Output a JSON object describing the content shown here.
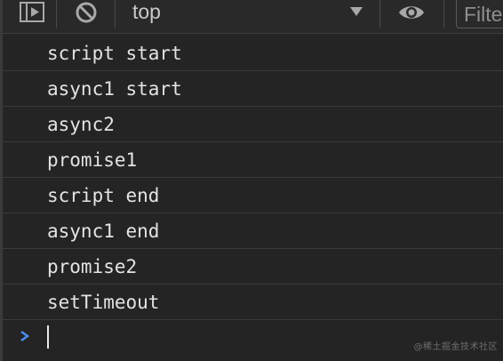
{
  "toolbar": {
    "icons": {
      "sidebar": "sidebar-toggle-icon",
      "clear": "clear-console-icon",
      "dropdown": "chevron-down-icon",
      "live_expression": "eye-icon"
    },
    "context": "top",
    "filter_placeholder": "Filter",
    "filter_value": ""
  },
  "console": {
    "messages": [
      "script start",
      "async1 start",
      "async2",
      "promise1",
      "script end",
      "async1 end",
      "promise2",
      "setTimeout"
    ],
    "prompt_icon": "prompt-chevron-icon"
  },
  "watermark": "@稀土掘金技术社区",
  "colors": {
    "background": "#242424",
    "text": "#e3e3e3",
    "prompt": "#4b8df0",
    "toolbar_icon": "#a8a8a8"
  }
}
